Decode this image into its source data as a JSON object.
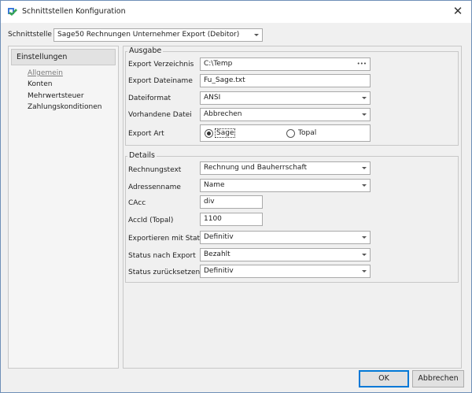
{
  "window": {
    "title": "Schnittstellen Konfiguration",
    "close_glyph": "✕"
  },
  "interface": {
    "label": "Schnittstelle",
    "value": "Sage50 Rechnungen Unternehmer Export (Debitor)"
  },
  "sidebar": {
    "header": "Einstellungen",
    "items": [
      {
        "label": "Allgemein",
        "active": true
      },
      {
        "label": "Konten",
        "active": false
      },
      {
        "label": "Mehrwertsteuer",
        "active": false
      },
      {
        "label": "Zahlungskonditionen",
        "active": false
      }
    ]
  },
  "ausgabe": {
    "title": "Ausgabe",
    "export_dir_label": "Export Verzeichnis",
    "export_dir_value": "C:\\Temp",
    "browse_glyph": "•••",
    "export_filename_label": "Export Dateiname",
    "export_filename_value": "Fu_Sage.txt",
    "file_format_label": "Dateiformat",
    "file_format_value": "ANSI",
    "existing_file_label": "Vorhandene Datei",
    "existing_file_value": "Abbrechen",
    "export_type_label": "Export Art",
    "export_type_options": [
      "Sage",
      "Topal"
    ],
    "export_type_selected": "Sage"
  },
  "details": {
    "title": "Details",
    "invoice_text_label": "Rechnungstext",
    "invoice_text_value": "Rechnung und Bauherrschaft",
    "address_name_label": "Adressenname",
    "address_name_value": "Name",
    "cacc_label": "CAcc",
    "cacc_value": "div",
    "accid_label": "AccId (Topal)",
    "accid_value": "1100",
    "export_with_status_label": "Exportieren mit Status",
    "export_with_status_value": "Definitiv",
    "status_after_export_label": "Status nach Export",
    "status_after_export_value": "Bezahlt",
    "status_reset_label": "Status zurücksetzen",
    "status_reset_value": "Definitiv"
  },
  "buttons": {
    "ok": "OK",
    "cancel": "Abbrechen"
  },
  "colors": {
    "accent": "#0078d7",
    "icon_green": "#3aa655",
    "icon_blue": "#3b7ad9"
  }
}
